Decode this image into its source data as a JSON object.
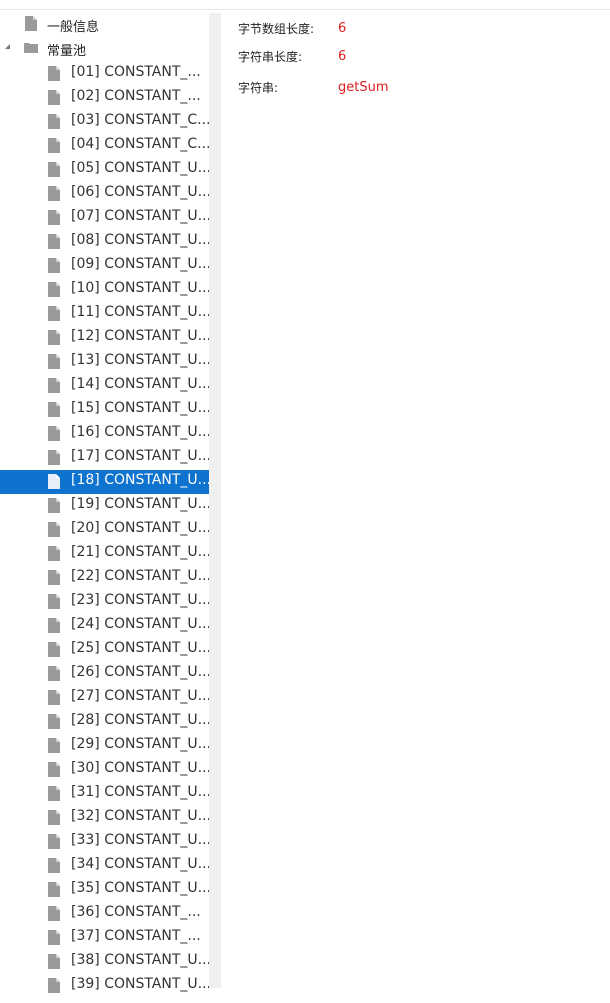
{
  "tree": {
    "general_info": "一般信息",
    "constant_pool": "常量池",
    "selected_index": 17,
    "entries": [
      "[01] CONSTANT_...",
      "[02] CONSTANT_...",
      "[03] CONSTANT_C...",
      "[04] CONSTANT_C...",
      "[05] CONSTANT_U...",
      "[06] CONSTANT_U...",
      "[07] CONSTANT_U...",
      "[08] CONSTANT_U...",
      "[09] CONSTANT_U...",
      "[10] CONSTANT_U...",
      "[11] CONSTANT_U...",
      "[12] CONSTANT_U...",
      "[13] CONSTANT_U...",
      "[14] CONSTANT_U...",
      "[15] CONSTANT_U...",
      "[16] CONSTANT_U...",
      "[17] CONSTANT_U...",
      "[18] CONSTANT_U...",
      "[19] CONSTANT_U...",
      "[20] CONSTANT_U...",
      "[21] CONSTANT_U...",
      "[22] CONSTANT_U...",
      "[23] CONSTANT_U...",
      "[24] CONSTANT_U...",
      "[25] CONSTANT_U...",
      "[26] CONSTANT_U...",
      "[27] CONSTANT_U...",
      "[28] CONSTANT_U...",
      "[29] CONSTANT_U...",
      "[30] CONSTANT_U...",
      "[31] CONSTANT_U...",
      "[32] CONSTANT_U...",
      "[33] CONSTANT_U...",
      "[34] CONSTANT_U...",
      "[35] CONSTANT_U...",
      "[36] CONSTANT_...",
      "[37] CONSTANT_...",
      "[38] CONSTANT_U...",
      "[39] CONSTANT_U..."
    ]
  },
  "detail": {
    "byte_length_label": "字节数组长度:",
    "byte_length_value": "6",
    "string_length_label": "字符串长度:",
    "string_length_value": "6",
    "string_label": "字符串:",
    "string_value": "getSum"
  },
  "colors": {
    "selection": "#0e73cf",
    "value_text": "#e02020",
    "icon_gray": "#9a9a9a"
  },
  "icons": {
    "entry": "file-icon",
    "folder": "folder-icon",
    "expander": "expand-arrow-icon"
  }
}
